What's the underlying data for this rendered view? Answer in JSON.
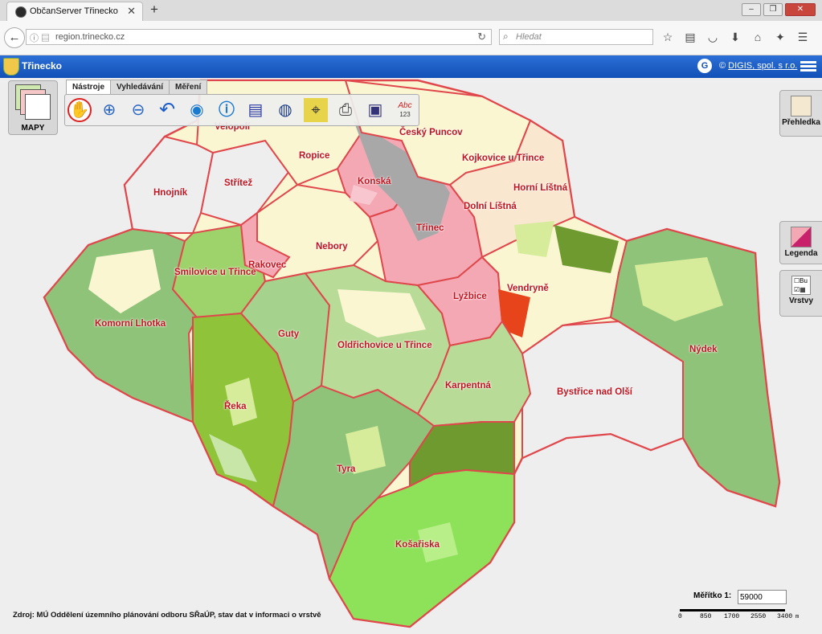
{
  "browser": {
    "tab_title": "ObčanServer Třinecko",
    "url": "region.trinecko.cz",
    "search_placeholder": "Hledat"
  },
  "app": {
    "title": "Třinecko",
    "copyright_symbol": "©",
    "copyright_link": "DIGIS, spol. s r.o."
  },
  "left_panel": {
    "maps_label": "MAPY"
  },
  "toolbar": {
    "tabs": [
      "Nástroje",
      "Vyhledávání",
      "Měření"
    ],
    "active_tab": "Nástroje",
    "tools": [
      "pan-hand",
      "zoom-in",
      "zoom-out",
      "back-arrow",
      "globe",
      "info",
      "document",
      "web-map",
      "target",
      "print",
      "save",
      "label-abc"
    ],
    "label_tool_text": "Abc",
    "label_tool_num": "123"
  },
  "right_panel": {
    "overview_label": "Přehledka",
    "legend_label": "Legenda",
    "layers_label": "Vrstvy",
    "layers_icon_text": "Bu"
  },
  "map": {
    "places": [
      "Velopolí",
      "Ropice",
      "Český Puncov",
      "Kojkovice u Třince",
      "Konská",
      "Hnojník",
      "Střítež",
      "Horní Líštná",
      "Dolní Líštná",
      "Třinec",
      "Nebory",
      "Rakovec",
      "Smilovice u Třince",
      "Vendryně",
      "Lyžbice",
      "Komorní Lhotka",
      "Guty",
      "Oldřichovice u Třince",
      "Nýdek",
      "Karpentná",
      "Bystřice nad Olší",
      "Řeka",
      "Tyra",
      "Košařiska"
    ],
    "colors": {
      "border": "#e0474c",
      "forest": "#8fc37a",
      "dark_forest": "#6e9a2f",
      "light_green": "#8ee25a",
      "urban": "#f4a8b4",
      "fields": "#fbf6d2",
      "industry": "#a8a8a8",
      "meadow": "#d6ec9a"
    }
  },
  "footer": {
    "source": "Zdroj: MÚ Oddělení územního plánování odboru SŘaÚP,  stav dat v informaci o vrstvě",
    "scale_label": "Měřítko  1:",
    "scale_value": "59000",
    "scale_ticks": [
      "0",
      "850",
      "1700",
      "2550",
      "3400"
    ],
    "scale_unit": "m"
  }
}
